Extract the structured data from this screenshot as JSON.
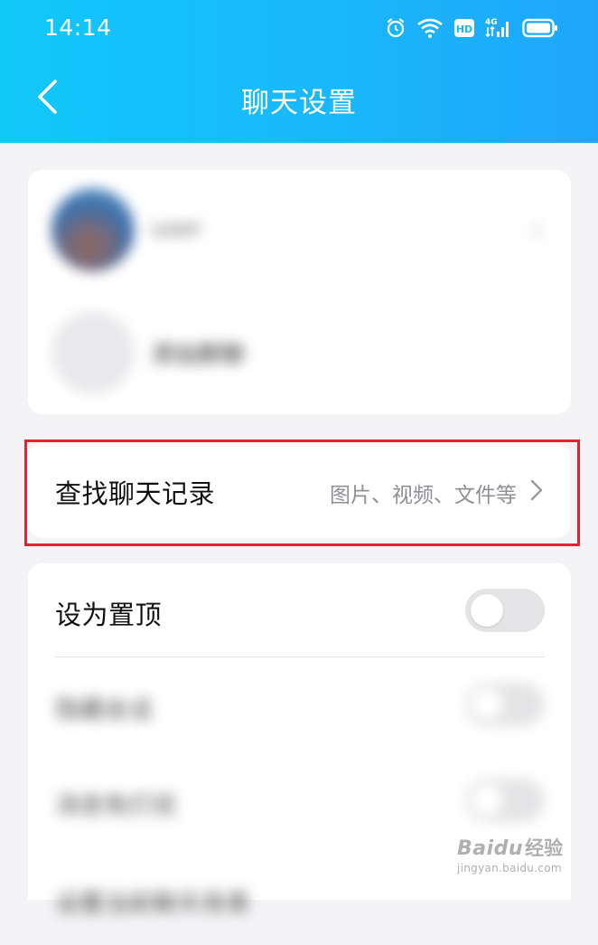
{
  "status_bar": {
    "time": "14:14",
    "icons": [
      "alarm-icon",
      "wifi-icon",
      "hd-icon",
      "signal-4g-icon",
      "battery-icon"
    ],
    "hd_badge": "HD",
    "network": "4G"
  },
  "nav": {
    "title": "聊天设置",
    "back_icon": "chevron-left-icon"
  },
  "members": {
    "primary_name": "user",
    "add_label": "添加群聊"
  },
  "search_history": {
    "label": "查找聊天记录",
    "hint": "图片、视频、文件等"
  },
  "settings": {
    "pin_top": {
      "label": "设为置顶",
      "enabled": false
    },
    "mute": {
      "label": "隐藏会话",
      "enabled": false
    },
    "dnd": {
      "label": "消息免打扰",
      "enabled": false
    },
    "more": {
      "label": "设置当前聊天背景"
    }
  },
  "watermark": {
    "brand": "Bai",
    "brand_suffix": "du",
    "sub": "经验",
    "url": "jingyan.baidu.com"
  },
  "colors": {
    "header_start": "#10c8f8",
    "header_end": "#1fa6fb",
    "highlight": "#e8202f",
    "background": "#f4f4f6"
  }
}
